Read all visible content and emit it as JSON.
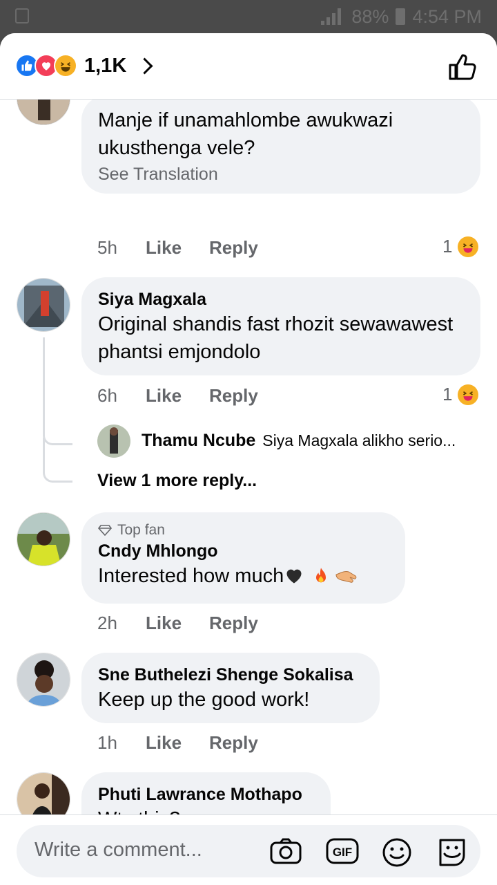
{
  "status_bar": {
    "battery": "88%",
    "time": "4:54 PM"
  },
  "header": {
    "reaction_count": "1,1K"
  },
  "comments": [
    {
      "text": "Manje if unamahlombe awukwazi ukusthenga vele?",
      "translation": "See Translation",
      "time": "5h",
      "like": "Like",
      "reply": "Reply",
      "reaction_count": "1"
    },
    {
      "name": "Siya Magxala",
      "text": "Original shandis fast rhozit sewawawest phantsi emjondolo",
      "time": "6h",
      "like": "Like",
      "reply": "Reply",
      "reaction_count": "1",
      "replies": {
        "name": "Thamu Ncube",
        "text": "Siya Magxala alikho serio...",
        "more": "View 1 more reply..."
      }
    },
    {
      "badge": "Top fan",
      "name": "Cndy Mhlongo",
      "text": "Interested how much",
      "time": "2h",
      "like": "Like",
      "reply": "Reply"
    },
    {
      "name": "Sne Buthelezi Shenge Sokalisa",
      "text": "Keep up the good work!",
      "time": "1h",
      "like": "Like",
      "reply": "Reply"
    },
    {
      "name": "Phuti Lawrance Mothapo",
      "text": "Wts this?"
    }
  ],
  "composer": {
    "placeholder": "Write a comment...",
    "icons": [
      "camera-icon",
      "gif-icon",
      "emoji-icon",
      "sticker-icon"
    ]
  },
  "colors": {
    "accent": "#1877f2",
    "love": "#f33e58",
    "haha": "#f7b125",
    "bubble": "#f0f2f5",
    "secondary_text": "#65676b"
  }
}
